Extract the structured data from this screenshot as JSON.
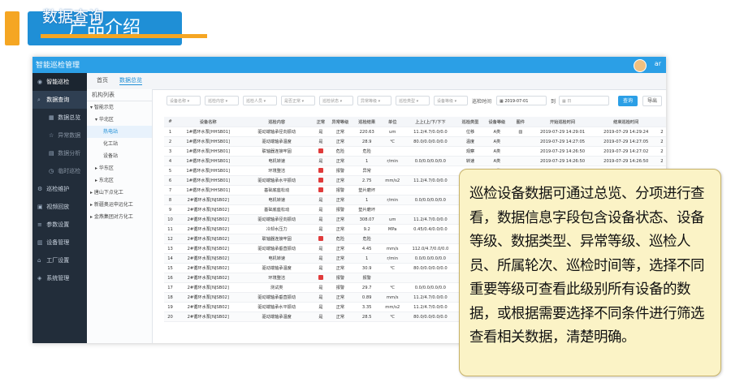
{
  "slide": {
    "title": "产品介绍",
    "accent_color": "#f5a623",
    "title_bg": "#1f8fd6"
  },
  "app": {
    "name": "智能巡检管理",
    "user": "ar",
    "overlay_title": "数据查询"
  },
  "sidebar": {
    "items": [
      {
        "label": "智能巡检",
        "icon": "user-circle-icon"
      },
      {
        "label": "数据查询",
        "icon": "search-icon"
      },
      {
        "label": "数据总览",
        "icon": "grid-icon"
      },
      {
        "label": "异常数据",
        "icon": "star-icon"
      },
      {
        "label": "数据分析",
        "icon": "chart-icon"
      },
      {
        "label": "临时巡检",
        "icon": "clock-icon"
      },
      {
        "label": "巡检维护",
        "icon": "gear-icon"
      },
      {
        "label": "视频回放",
        "icon": "video-icon"
      },
      {
        "label": "参数设置",
        "icon": "sliders-icon"
      },
      {
        "label": "设备管理",
        "icon": "device-icon"
      },
      {
        "label": "工厂设置",
        "icon": "factory-icon"
      },
      {
        "label": "系统管理",
        "icon": "location-icon"
      }
    ]
  },
  "tabs": [
    "首页",
    "数据总览"
  ],
  "tree": {
    "header": "机构列表",
    "items": [
      "智能示范",
      "华北区",
      "热电站",
      "化工站",
      "设备站",
      "华东区",
      "东北区",
      "唐山下点化工",
      "新疆奥运申远化工",
      "金燕集团对方化工"
    ]
  },
  "filters": {
    "placeholders": [
      "设备名称",
      "巡检内容",
      "巡检人员",
      "是否正常",
      "巡检状态",
      "异常等级",
      "巡检类型",
      "设备等级"
    ],
    "time_label": "巡检时间",
    "start_date": "2019-07-01",
    "to_label": "到",
    "end_placeholder": "日",
    "query_btn": "查询",
    "export_btn": "导出"
  },
  "table": {
    "columns": [
      "#",
      "设备名称",
      "巡检内容",
      "正常",
      "异常等级",
      "巡检结果",
      "单位",
      "上上(上/下/下下",
      "巡检类型",
      "设备等级",
      "图件",
      "开始巡检时间",
      "结束巡检时间",
      ""
    ],
    "rows": [
      [
        "1",
        "1#循环水泵[HHSB01]",
        "驱动端轴承径向振动",
        "是",
        "正常",
        "220.63",
        "um",
        "11.2/4.7/0.0/0.0",
        "位移",
        "A类",
        "",
        "2019-07-29 14:29:01",
        "2019-07-29 14:29:24",
        "2"
      ],
      [
        "2",
        "1#循环水泵[HHSB01]",
        "驱动端轴承温度",
        "是",
        "正常",
        "28.9",
        "℃",
        "80.0/0.0/0.0/0.0",
        "温度",
        "A类",
        "",
        "2019-07-29 14:27:05",
        "2019-07-29 14:27:05",
        "2"
      ],
      [
        "3",
        "1#循环水泵[HHSB01]",
        "联轴器连接牢固",
        "否",
        "危险",
        "危险",
        "",
        "",
        "观察",
        "A类",
        "",
        "2019-07-29 14:26:50",
        "2019-07-29 14:27:02",
        "2"
      ],
      [
        "4",
        "1#循环水泵[HHSB01]",
        "电机转速",
        "是",
        "正常",
        "1",
        "r/min",
        "0.0/0.0/0.0/0.0",
        "转速",
        "A类",
        "",
        "2019-07-29 14:26:50",
        "2019-07-29 14:26:50",
        "2"
      ],
      [
        "5",
        "1#循环水泵[HHSB01]",
        "环境整洁",
        "否",
        "报警",
        "异常",
        "",
        "",
        "",
        "A类",
        "",
        "2019-07-29 14:21:07",
        "2019-07-29 14:21:31",
        "2"
      ],
      [
        "6",
        "1#循环水泵[HHSB01]",
        "驱动端轴承水平振动",
        "否",
        "正常",
        "2.75",
        "mm/s2",
        "11.2/4.7/0.0/0.0",
        "",
        "A类",
        "",
        "",
        "",
        "2"
      ],
      [
        "7",
        "1#循环水泵[HHSB01]",
        "基础底座松动",
        "否",
        "报警",
        "垫片磨坏",
        "",
        "",
        "",
        "",
        "",
        "",
        "",
        "2"
      ],
      [
        "8",
        "2#循环水泵[NJSB02]",
        "电机转速",
        "是",
        "正常",
        "1",
        "r/min",
        "0.0/0.0/0.0/0.0",
        "",
        "",
        "",
        "",
        "",
        "2"
      ],
      [
        "9",
        "2#循环水泵[NJSB02]",
        "基础底座松动",
        "是",
        "报警",
        "垫片磨坏",
        "",
        "",
        "",
        "",
        "",
        "",
        "",
        "2"
      ],
      [
        "10",
        "2#循环水泵[NJSB02]",
        "驱动端轴承径向振动",
        "是",
        "正常",
        "308.07",
        "um",
        "11.2/4.7/0.0/0.0",
        "",
        "",
        "",
        "",
        "",
        "2"
      ],
      [
        "11",
        "2#循环水泵[NJSB02]",
        "冷却水压力",
        "是",
        "正常",
        "9.2",
        "MPa",
        "0.45/0.4/0.0/0.0",
        "",
        "",
        "",
        "",
        "",
        "2"
      ],
      [
        "12",
        "2#循环水泵[NJSB02]",
        "联轴器连接牢固",
        "否",
        "危险",
        "危险",
        "",
        "",
        "",
        "",
        "",
        "",
        "",
        "2"
      ],
      [
        "13",
        "2#循环水泵[NJSB02]",
        "驱动端轴承垂直振动",
        "是",
        "正常",
        "4.45",
        "mm/s",
        "112.0/4.7/0.0/0.0",
        "",
        "",
        "",
        "",
        "",
        "2"
      ],
      [
        "14",
        "2#循环水泵[NJSB02]",
        "电机转速",
        "是",
        "正常",
        "1",
        "r/min",
        "0.0/0.0/0.0/0.0",
        "",
        "",
        "",
        "",
        "",
        "2"
      ],
      [
        "15",
        "2#循环水泵[NJSB02]",
        "驱动端轴承温度",
        "是",
        "正常",
        "30.9",
        "℃",
        "80.0/0.0/0.0/0.0",
        "",
        "",
        "",
        "",
        "",
        "2"
      ],
      [
        "16",
        "2#循环水泵[NJSB02]",
        "环境整洁",
        "否",
        "报警",
        "报警",
        "",
        "",
        "",
        "",
        "",
        "",
        "",
        "2"
      ],
      [
        "17",
        "2#循环水泵[NJSB02]",
        "测试类",
        "是",
        "报警",
        "29.7",
        "℃",
        "0.0/0.0/0.0/0.0",
        "",
        "",
        "",
        "",
        "",
        "2"
      ],
      [
        "18",
        "2#循环水泵[NJSB02]",
        "驱动端轴承垂直振动",
        "是",
        "正常",
        "0.89",
        "mm/s",
        "11.2/4.7/0.0/0.0",
        "",
        "",
        "",
        "",
        "",
        "2"
      ],
      [
        "19",
        "2#循环水泵[NJSB02]",
        "驱动端轴承水平振动",
        "是",
        "正常",
        "3.35",
        "mm/s2",
        "11.2/4.7/0.0/0.0",
        "",
        "",
        "",
        "",
        "",
        "2"
      ],
      [
        "20",
        "2#循环水泵[NJSB02]",
        "驱动端轴承温度",
        "是",
        "正常",
        "28.5",
        "℃",
        "80.0/0.0/0.0/0.0",
        "",
        "",
        "",
        "",
        "",
        "2"
      ]
    ]
  },
  "callout": {
    "text": "巡检设备数据可通过总览、分项进行查看，数据信息字段包含设备状态、设备等级、数据类型、异常等级、巡检人员、所属轮次、巡检时间等，选择不同重要等级可查看此级别所有设备的数据，或根据需要选择不同条件进行筛选查看相关数据，清楚明确。"
  }
}
